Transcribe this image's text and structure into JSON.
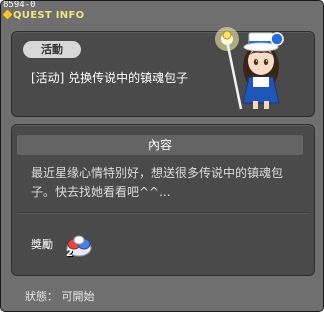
{
  "window": {
    "quest_id": "8594-0",
    "title": "QUEST INFO"
  },
  "quest": {
    "category_tag": "活動",
    "name": "[活动] 兑换传说中的镇魂包子"
  },
  "content": {
    "header": "內容",
    "description": "最近星缘心情特别好，想送很多传说中的镇魂包子。快去找她看看吧^^..."
  },
  "reward": {
    "label": "獎勵",
    "item_icon": "bun-item-icon",
    "item_count": "2"
  },
  "status": {
    "text": "狀態： 可開始"
  },
  "colors": {
    "window_bg": "#6f6f6f",
    "panel_bg": "#4a4a4a",
    "title": "#f1e483",
    "tag_bg": "#d8d8d8"
  }
}
